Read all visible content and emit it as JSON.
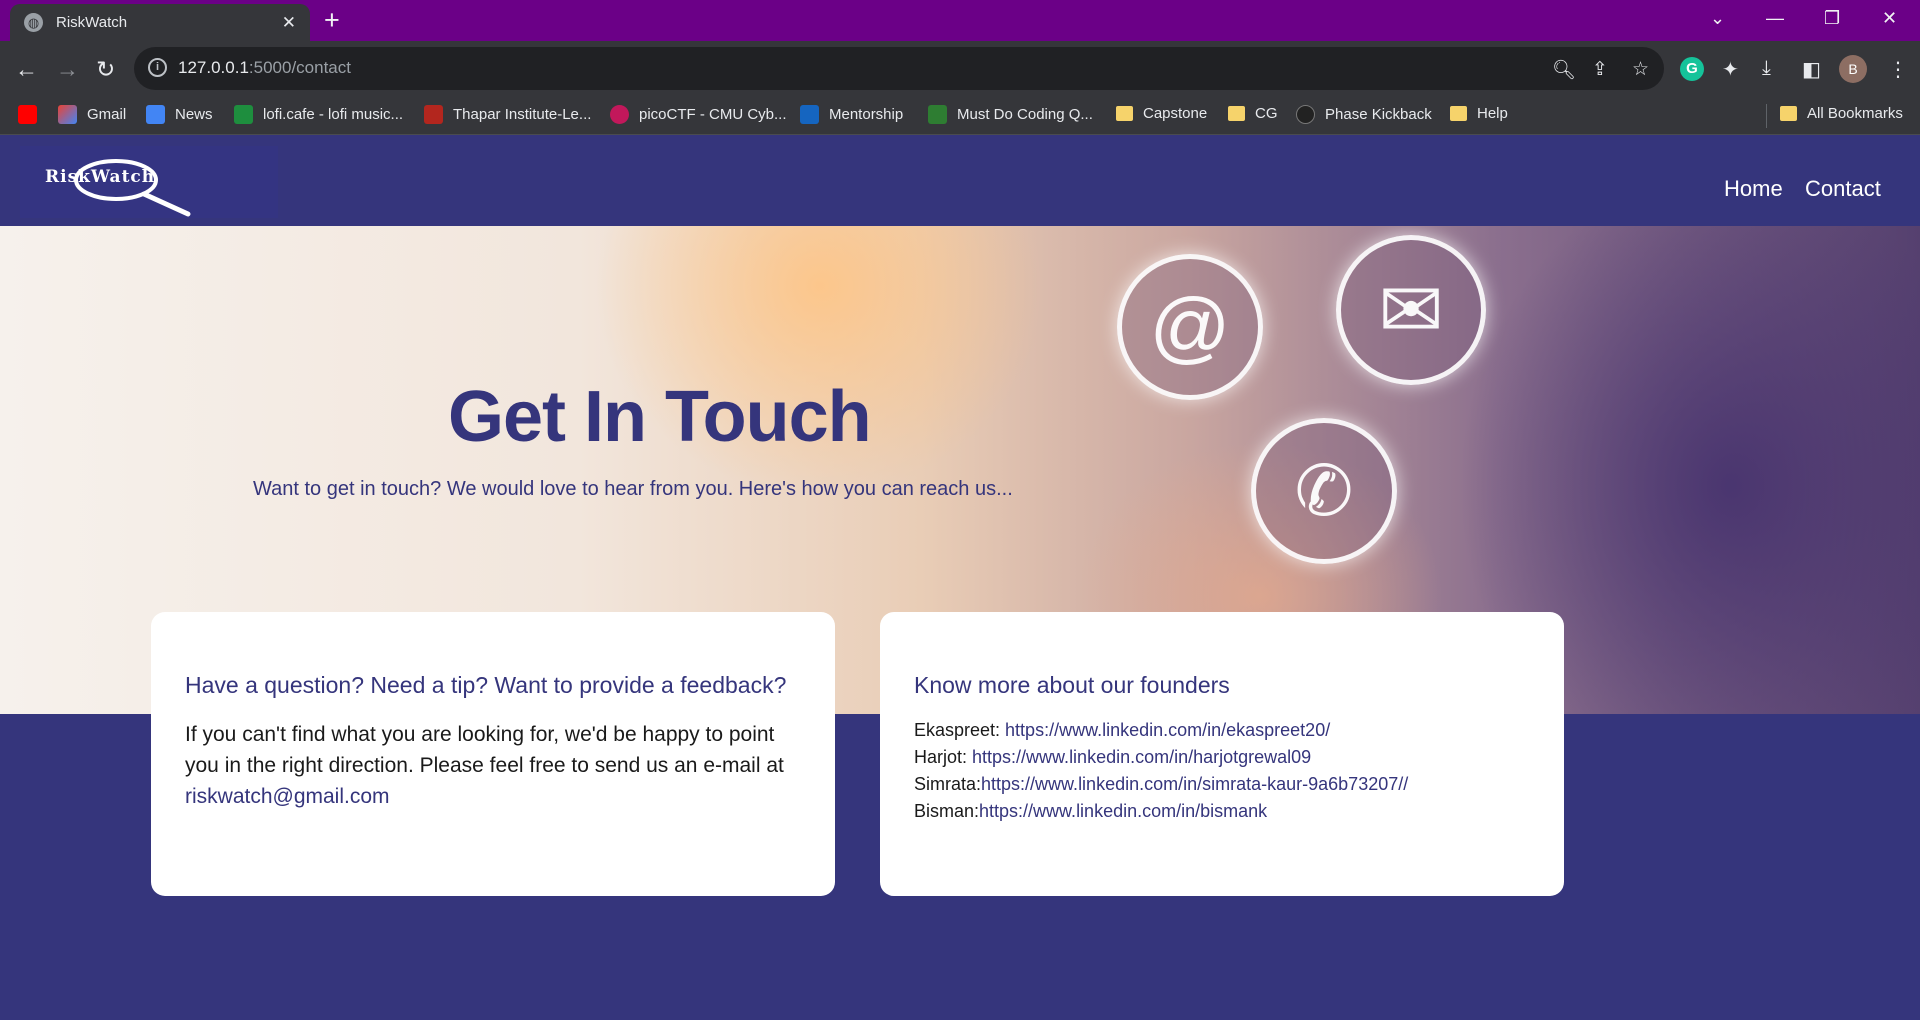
{
  "browser": {
    "tab_title": "RiskWatch",
    "url_host": "127.0.0.1",
    "url_path": ":5000/contact",
    "profile_initial": "B",
    "bookmarks": [
      "Gmail",
      "News",
      "lofi.cafe - lofi music...",
      "Thapar Institute-Le...",
      "picoCTF - CMU Cyb...",
      "Mentorship",
      "Must Do Coding Q...",
      "Capstone",
      "CG",
      "Phase Kickback",
      "Help"
    ],
    "all_bookmarks": "All Bookmarks"
  },
  "navbar": {
    "logo_text": "RiskWatch",
    "links": [
      "Home",
      "Contact"
    ]
  },
  "hero": {
    "title": "Get In Touch",
    "subtitle": "Want to get in touch? We would love to hear from you. Here's how you can reach us..."
  },
  "contact_card": {
    "heading": "Have a question? Need a tip? Want to provide a feedback?",
    "body": "If you can't find what you are looking for, we'd be happy to point you in the right direction. Please feel free to send us an e-mail at",
    "email": "riskwatch@gmail.com"
  },
  "founders_card": {
    "heading": "Know more about our founders",
    "founders": [
      {
        "label": "Ekaspreet: ",
        "link": "https://www.linkedin.com/in/ekaspreet20/"
      },
      {
        "label": "Harjot: ",
        "link": "https://www.linkedin.com/in/harjotgrewal09"
      },
      {
        "label": "Simrata:",
        "link": "https://www.linkedin.com/in/simrata-kaur-9a6b73207//"
      },
      {
        "label": "Bisman:",
        "link": "https://www.linkedin.com/in/bismank"
      }
    ]
  },
  "colors": {
    "brand": "#35357c",
    "tabbar": "#6b0087",
    "card": "#ffffff"
  }
}
